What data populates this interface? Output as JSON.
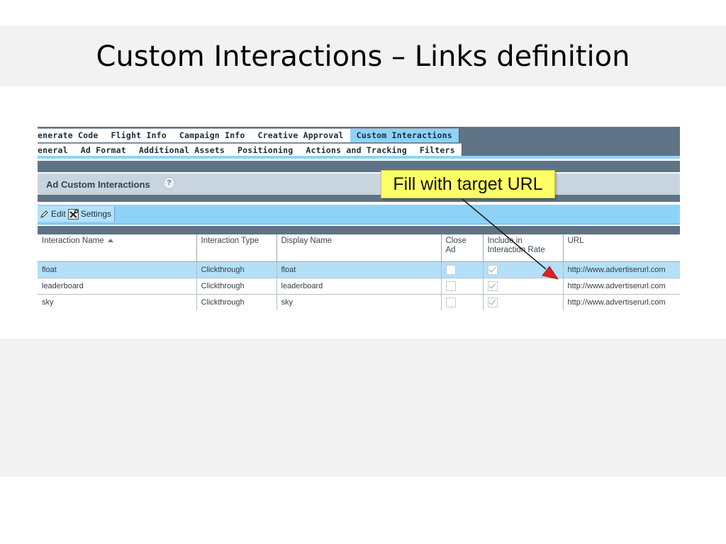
{
  "slide": {
    "title": "Custom Interactions – Links definition"
  },
  "tabs_row1": [
    {
      "label": "enerate Code",
      "active": false
    },
    {
      "label": "Flight Info",
      "active": false
    },
    {
      "label": "Campaign Info",
      "active": false
    },
    {
      "label": "Creative Approval",
      "active": false
    },
    {
      "label": "Custom Interactions",
      "active": true
    }
  ],
  "tabs_row2": [
    {
      "label": "eneral"
    },
    {
      "label": "Ad Format"
    },
    {
      "label": "Additional Assets"
    },
    {
      "label": "Positioning"
    },
    {
      "label": "Actions and Tracking"
    },
    {
      "label": "Filters"
    }
  ],
  "section": {
    "title": "Ad Custom Interactions",
    "help_glyph": "?"
  },
  "toolbar": {
    "edit_label": "Edit",
    "settings_label": "Settings",
    "edit_icon": "pencil-icon",
    "settings_icon": "tools-icon"
  },
  "table": {
    "headers": {
      "name": "Interaction Name",
      "type": "Interaction Type",
      "display": "Display Name",
      "close_line1": "Close",
      "close_line2": "Ad",
      "include_line1": "Include in",
      "include_line2": "Interaction Rate",
      "url": "URL"
    },
    "rows": [
      {
        "name": "float",
        "type": "Clickthrough",
        "display": "float",
        "close_ad": false,
        "include_rate": true,
        "url": "http://www.advertiserurl.com",
        "selected": true
      },
      {
        "name": "leaderboard",
        "type": "Clickthrough",
        "display": "leaderboard",
        "close_ad": false,
        "include_rate": true,
        "url": "http://www.advertiserurl.com",
        "selected": false
      },
      {
        "name": "sky",
        "type": "Clickthrough",
        "display": "sky",
        "close_ad": false,
        "include_rate": true,
        "url": "http://www.advertiserurl.com",
        "selected": false
      }
    ]
  },
  "annotation": {
    "callout_text": "Fill with target URL",
    "arrow_color": "#e02020"
  },
  "colors": {
    "tab_bar": "#5e7385",
    "accent_blue": "#8ed3f7",
    "selected_row": "#b3e0f8",
    "callout_bg": "#ffff66"
  }
}
